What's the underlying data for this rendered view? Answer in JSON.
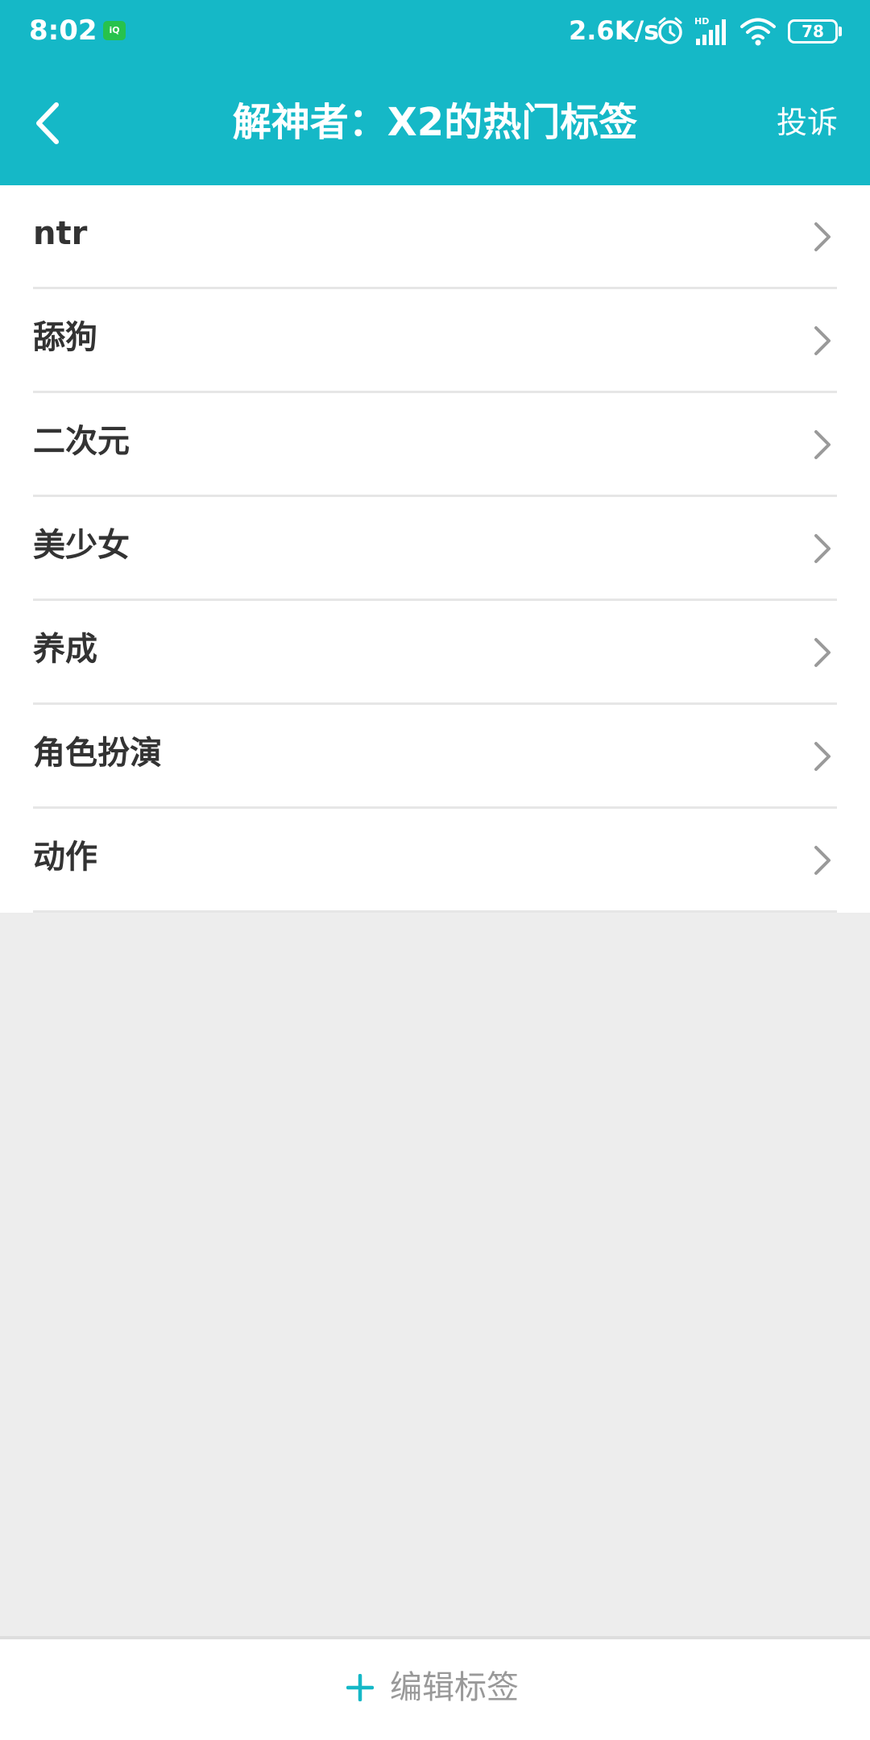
{
  "status_bar": {
    "time": "8:02",
    "app_badge": "爱奇艺",
    "network_speed": "2.6K/s",
    "battery_level": "78"
  },
  "header": {
    "title": "解神者：X2的热门标签",
    "report_label": "投诉",
    "background_color": "#15b8c7"
  },
  "tags": [
    {
      "label": "ntr"
    },
    {
      "label": "舔狗"
    },
    {
      "label": "二次元"
    },
    {
      "label": "美少女"
    },
    {
      "label": "养成"
    },
    {
      "label": "角色扮演"
    },
    {
      "label": "动作"
    }
  ],
  "bottom_bar": {
    "edit_tags_label": "编辑标签",
    "accent_color": "#15b8c7"
  },
  "icons": {
    "back": "chevron-left-icon",
    "row_arrow": "chevron-right-icon",
    "plus": "plus-icon",
    "alarm": "alarm-clock-icon",
    "signal": "cellular-signal-icon",
    "wifi": "wifi-icon",
    "battery": "battery-icon"
  }
}
